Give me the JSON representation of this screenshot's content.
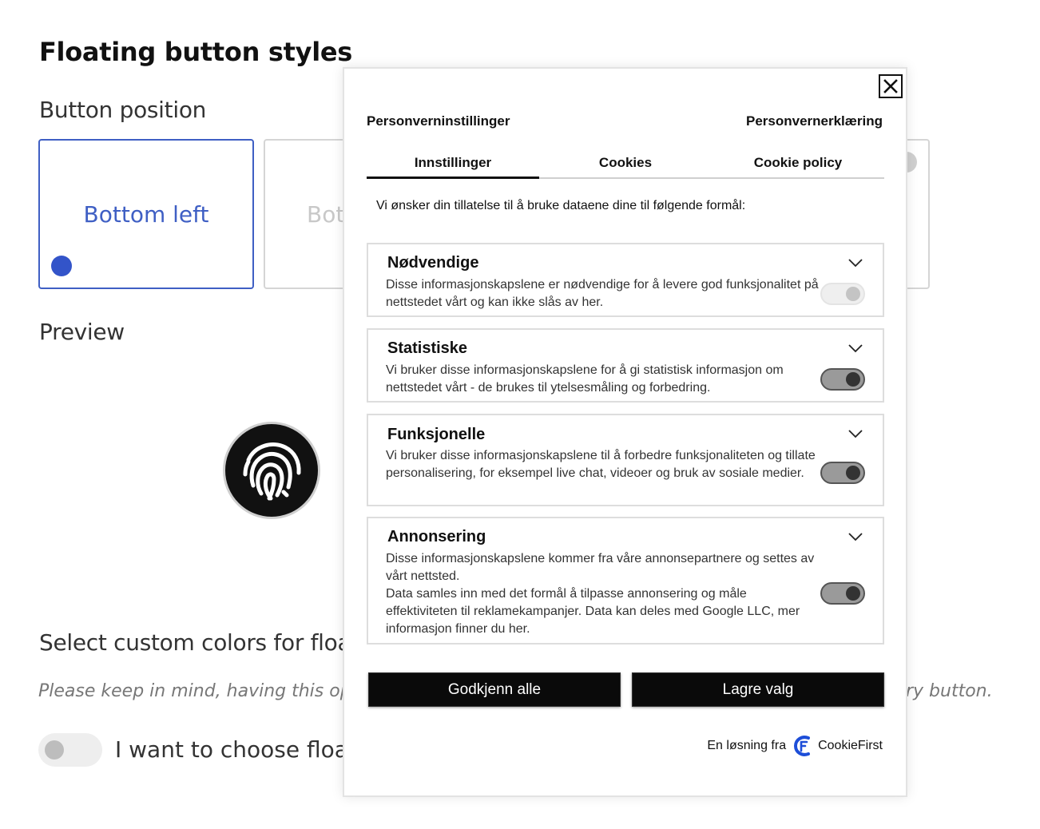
{
  "page": {
    "title": "Floating button styles",
    "button_position_heading": "Button position",
    "positions": [
      {
        "label": "Bottom left",
        "selected": true
      },
      {
        "label": "Bot",
        "selected": false
      }
    ],
    "preview_heading": "Preview",
    "fingerprint_icon": "fingerprint-icon",
    "custom_colors_heading": "Select custom colors for floati",
    "note_left": "Please keep in mind, having this option",
    "note_right": "ry button.",
    "toggle_label": "I want to choose floati"
  },
  "modal": {
    "close_icon": "close-icon",
    "header_left": "Personverninstillinger",
    "header_right": "Personvernerklæring",
    "tabs": [
      {
        "label": "Innstillinger",
        "active": true
      },
      {
        "label": "Cookies",
        "active": false
      },
      {
        "label": "Cookie policy",
        "active": false
      }
    ],
    "intro": "Vi ønsker din tillatelse til å bruke dataene dine til følgende formål:",
    "categories": [
      {
        "title": "Nødvendige",
        "description": "Disse informasjonskapslene er nødvendige for å levere god funksjonalitet på nettstedet vårt og kan ikke slås av her.",
        "enabled": true,
        "disabled": true
      },
      {
        "title": "Statistiske",
        "description": "Vi bruker disse informasjonskapslene for å gi statistisk informasjon om nettstedet vårt - de brukes til ytelsesmåling og forbedring.",
        "enabled": true,
        "disabled": false
      },
      {
        "title": "Funksjonelle",
        "description": "Vi bruker disse informasjonskapslene til å forbedre funksjonaliteten og tillate personalisering, for eksempel live chat, videoer og bruk av sosiale medier.",
        "enabled": true,
        "disabled": false
      },
      {
        "title": "Annonsering",
        "description": "Disse informasjonskapslene kommer fra våre annonsepartnere og settes av vårt nettsted.",
        "description2": "Data samles inn med det formål å tilpasse annonsering og måle effektiviteten til reklamekampanjer. Data kan deles med Google LLC, mer informasjon finner du her.",
        "enabled": true,
        "disabled": false
      }
    ],
    "accept_all": "Godkjenn alle",
    "save": "Lagre valg",
    "footer_text": "En løsning fra",
    "brand": "CookieFirst",
    "colors": {
      "primary_button": "#0a0a0a",
      "brand_blue": "#1d4ed8",
      "accent": "#3f5fc4"
    }
  }
}
